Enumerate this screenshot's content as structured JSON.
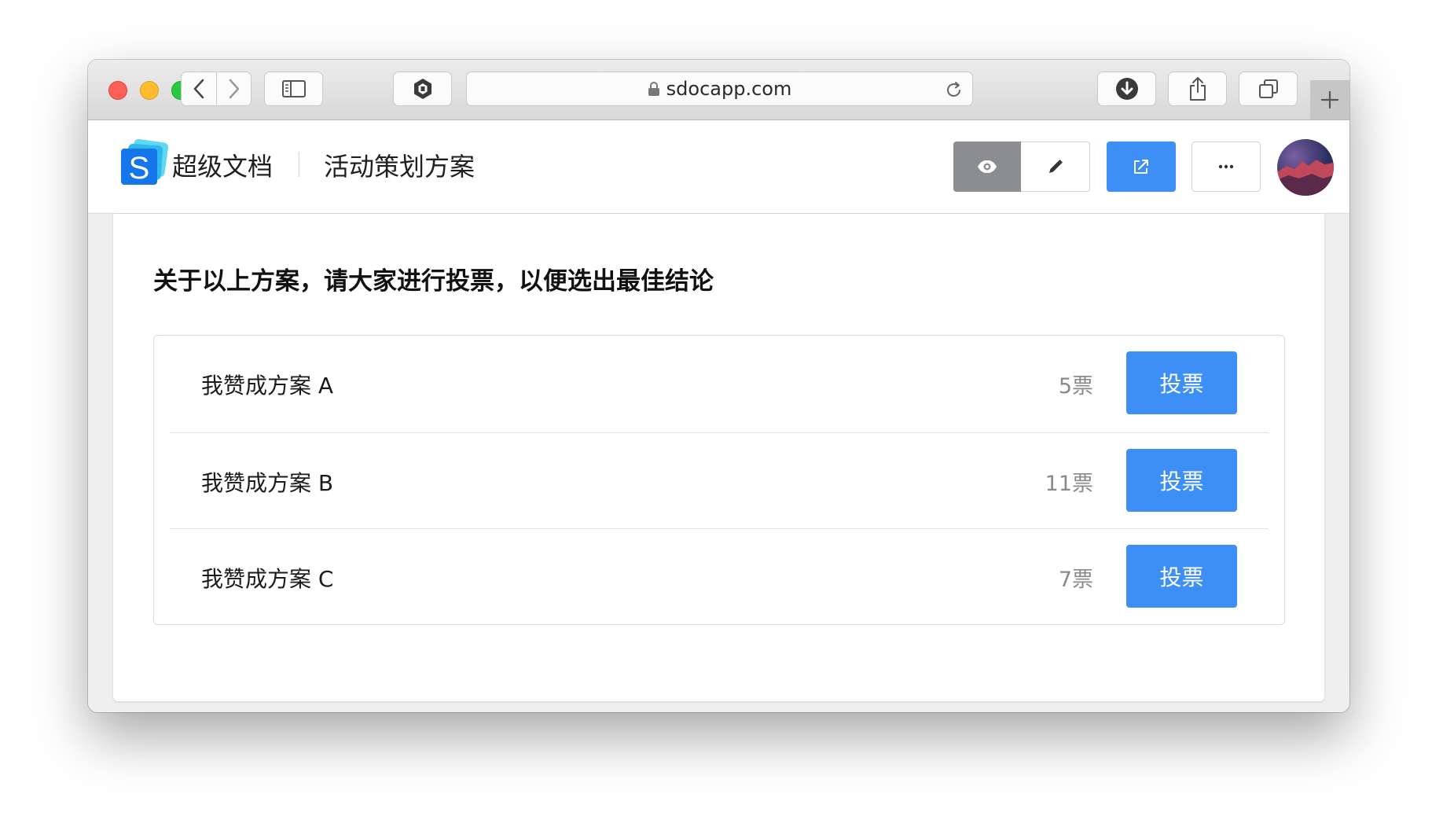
{
  "browser": {
    "url": "sdocapp.com",
    "icons": {
      "back": "chevron-left-icon",
      "forward": "chevron-right-icon",
      "sidebar": "sidebar-icon",
      "extension": "hexagon-extension-icon",
      "lock": "lock-icon",
      "reload": "reload-icon",
      "download": "download-icon",
      "share": "share-icon",
      "tabs": "tabs-overview-icon",
      "new_tab": "plus-icon"
    }
  },
  "app": {
    "brand": "超级文档",
    "doc_title": "活动策划方案",
    "accent_color": "#3d8ff5",
    "toolbar": {
      "view_icon": "eye-icon",
      "edit_icon": "pencil-icon",
      "share_icon": "external-share-icon",
      "more_icon": "more-icon"
    }
  },
  "poll": {
    "question": "关于以上方案，请大家进行投票，以便选出最佳结论",
    "options": [
      {
        "label": "我赞成方案 A",
        "count": "5票",
        "button": "投票"
      },
      {
        "label": "我赞成方案 B",
        "count": "11票",
        "button": "投票"
      },
      {
        "label": "我赞成方案 C",
        "count": "7票",
        "button": "投票"
      }
    ]
  }
}
